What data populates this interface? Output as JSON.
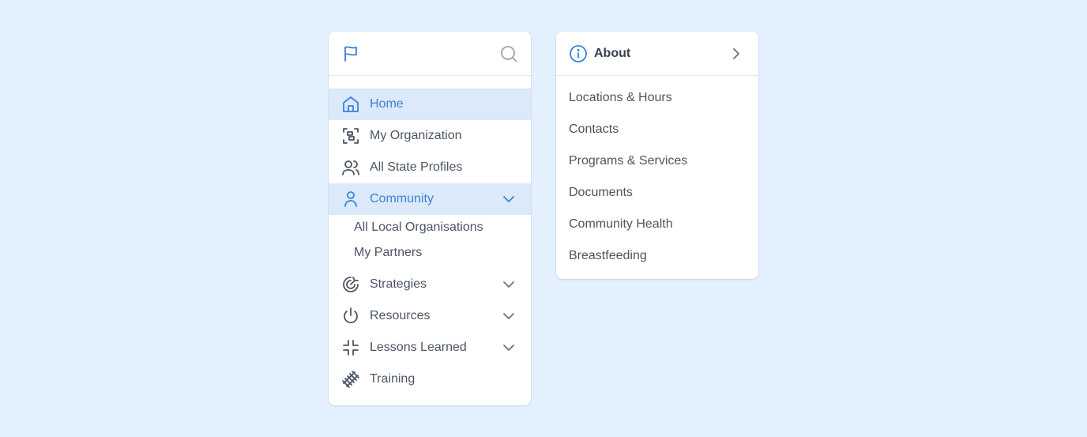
{
  "colors": {
    "background": "#e3f0fd",
    "accent": "#3b82d6",
    "active_bg": "#dbe9fb",
    "text": "#4b5563"
  },
  "nav": {
    "header": {
      "logo_icon": "flag-icon",
      "search_icon": "search-icon"
    },
    "items": [
      {
        "label": "Home",
        "icon": "home-icon",
        "active": true
      },
      {
        "label": "My Organization",
        "icon": "organization-icon"
      },
      {
        "label": "All State Profiles",
        "icon": "users-icon"
      },
      {
        "label": "Community",
        "icon": "user-icon",
        "active": true,
        "expanded": true,
        "children": [
          {
            "label": "All Local Organisations"
          },
          {
            "label": "My Partners"
          }
        ]
      },
      {
        "label": "Strategies",
        "icon": "target-arrow-icon",
        "expandable": true
      },
      {
        "label": "Resources",
        "icon": "power-icon",
        "expandable": true
      },
      {
        "label": "Lessons Learned",
        "icon": "minimize-icon",
        "expandable": true
      },
      {
        "label": "Training",
        "icon": "railroad-track-icon"
      }
    ]
  },
  "about": {
    "title": "About",
    "icon": "info-icon",
    "items": [
      "Locations & Hours",
      "Contacts",
      "Programs & Services",
      "Documents",
      "Community Health",
      "Breastfeeding"
    ]
  }
}
